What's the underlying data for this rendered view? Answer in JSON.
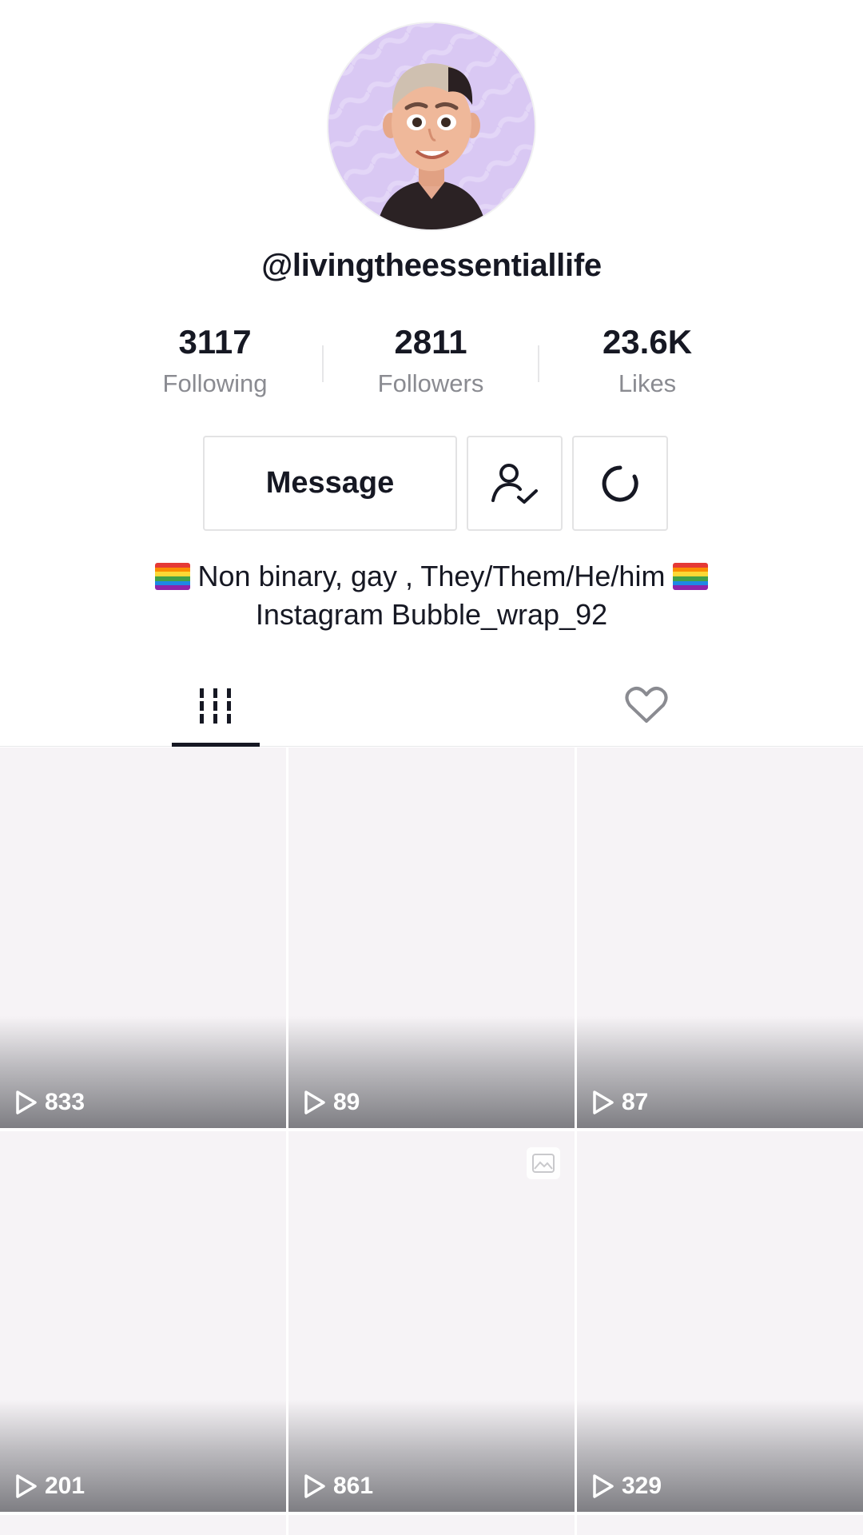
{
  "profile": {
    "username": "@livingtheessentiallife",
    "stats": [
      {
        "value": "3117",
        "label": "Following"
      },
      {
        "value": "2811",
        "label": "Followers"
      },
      {
        "value": "23.6K",
        "label": "Likes"
      }
    ],
    "bio_line1": "Non binary, gay , They/Them/He/him",
    "bio_line2": "Instagram Bubble_wrap_92"
  },
  "actions": {
    "message_label": "Message",
    "friend_icon": "user-check-icon",
    "more_icon": "refresh-icon"
  },
  "tabs": [
    {
      "icon": "videos-grid-icon",
      "active": true
    },
    {
      "icon": "heart-icon",
      "active": false
    }
  ],
  "videos": [
    {
      "views": "833"
    },
    {
      "views": "89"
    },
    {
      "views": "87"
    },
    {
      "views": "201"
    },
    {
      "views": "861"
    },
    {
      "views": "329"
    }
  ],
  "colors": {
    "text": "#161823",
    "muted": "#8a8b91",
    "border": "#e3e3e4",
    "tile_bg": "#f6f3f6",
    "avatar_bg": "#d8c7f2"
  }
}
